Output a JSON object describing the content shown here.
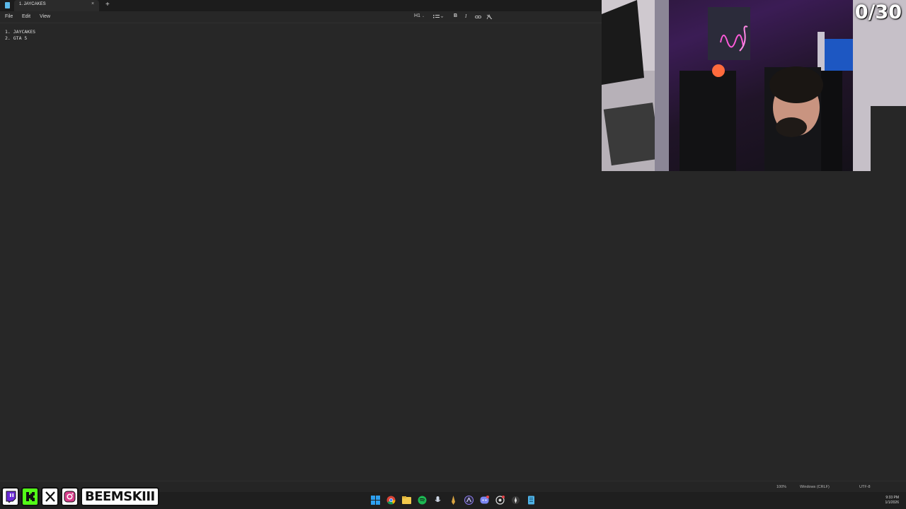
{
  "tab": {
    "title": "1. JAYCAKES",
    "close": "×",
    "new": "+"
  },
  "menu": [
    "File",
    "Edit",
    "View"
  ],
  "toolbar": {
    "heading": "H1",
    "bold": "B",
    "italic": "I"
  },
  "editor": {
    "lines": [
      "1. JAYCAKES",
      "2. GTA 5"
    ]
  },
  "status": {
    "zoom": "100%",
    "line_ending": "Windows (CRLF)",
    "encoding": "UTF-8"
  },
  "clock": {
    "time": "9:33 PM",
    "date": "1/1/2026"
  },
  "overlay": {
    "counter": "0/30",
    "handle": "BEEMSKIII"
  },
  "icons": [
    "notepad-icon",
    "bulleted-list-icon",
    "link-icon",
    "clear-formatting-icon",
    "windows-start-icon",
    "chrome-icon",
    "file-explorer-icon",
    "spotify-icon",
    "twitch-icon",
    "kick-icon",
    "x-icon",
    "instagram-icon"
  ]
}
